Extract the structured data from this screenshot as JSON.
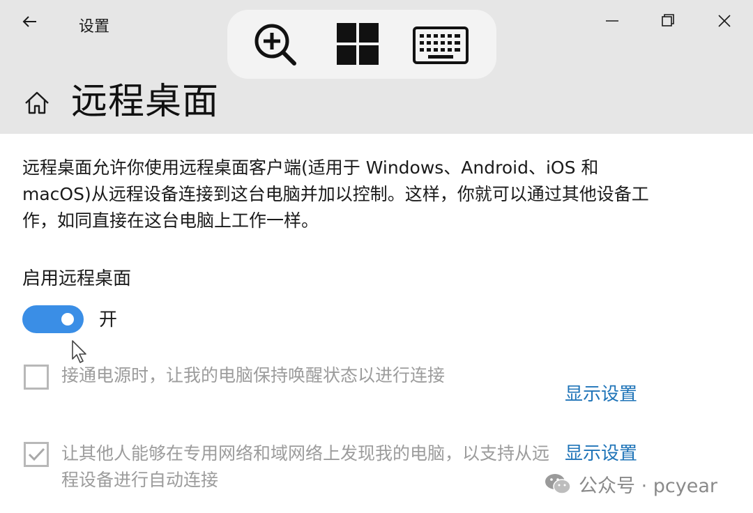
{
  "window": {
    "title": "设置"
  },
  "page": {
    "title": "远程桌面",
    "description": "远程桌面允许你使用远程桌面客户端(适用于 Windows、Android、iOS 和 macOS)从远程设备连接到这台电脑并加以控制。这样，你就可以通过其他设备工作，如同直接在这台电脑上工作一样。"
  },
  "remote_desktop": {
    "label": "启用远程桌面",
    "toggle_state": "开",
    "toggle_on": true,
    "accent_color": "#3a8ee6"
  },
  "options": [
    {
      "label": "接通电源时，让我的电脑保持唤醒状态以进行连接",
      "checked": false,
      "link": "显示设置"
    },
    {
      "label": "让其他人能够在专用网络和域网络上发现我的电脑，以支持从远程设备进行自动连接",
      "checked": true,
      "link": "显示设置"
    }
  ],
  "toolbar": {
    "icons": [
      "magnifier-icon",
      "windows-start-icon",
      "keyboard-icon"
    ]
  },
  "watermark": {
    "text": "公众号 · pcyear"
  }
}
